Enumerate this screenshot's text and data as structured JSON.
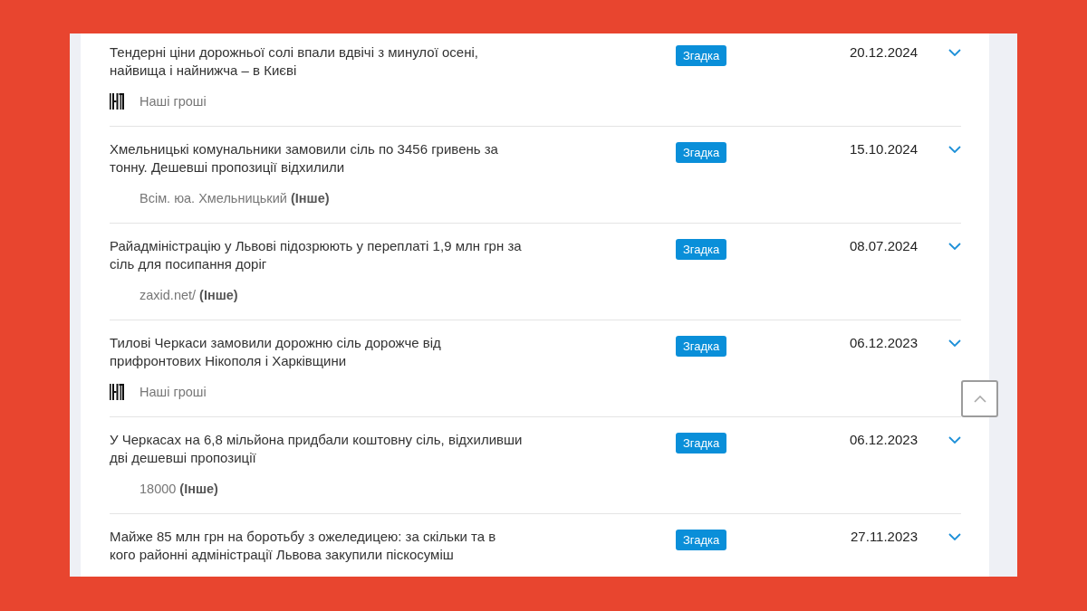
{
  "rows": [
    {
      "title": "Тендерні ціни дорожньої солі впали вдвічі з минулої осені,\nнайвища і найнижча – в Києві",
      "tag": "Згадка",
      "date": "20.12.2024",
      "expanded": false,
      "source": "Наші гроші",
      "source_logo": true
    },
    {
      "title": "Хмельницькі комунальники замовили сіль по 3456 гривень за\nтонну. Дешевші пропозиції відхилили",
      "tag": "Згадка",
      "date": "15.10.2024",
      "expanded": false,
      "source": "Всім. юа. Хмельницький **(Інше)**",
      "source_logo": false
    },
    {
      "title": "Райадміністрацію у Львові підозрюють у переплаті 1,9 млн грн за\nсіль для посипання доріг",
      "tag": "Згадка",
      "date": "08.07.2024",
      "expanded": false,
      "source": "zaxid.net/ **(Інше)**",
      "source_logo": false
    },
    {
      "title": "Тилові Черкаси замовили дорожню сіль дорожче від\nприфронтових Нікополя і Харківщини",
      "tag": "Згадка",
      "date": "06.12.2023",
      "expanded": false,
      "source": "Наші гроші",
      "source_logo": true
    },
    {
      "title": "У Черкасах на 6,8 мільйона придбали коштовну сіль, відхиливши\nдві дешевші пропозиції",
      "tag": "Згадка",
      "date": "06.12.2023",
      "expanded": false,
      "source": "18000 **(Інше)**",
      "source_logo": false
    },
    {
      "title": "Майже 85 млн грн на боротьбу з ожеледицею: за скільки та в\nкого районні адміністрації Львова закупили піскосуміш",
      "tag": "Згадка",
      "date": "27.11.2023",
      "expanded": false
    }
  ]
}
